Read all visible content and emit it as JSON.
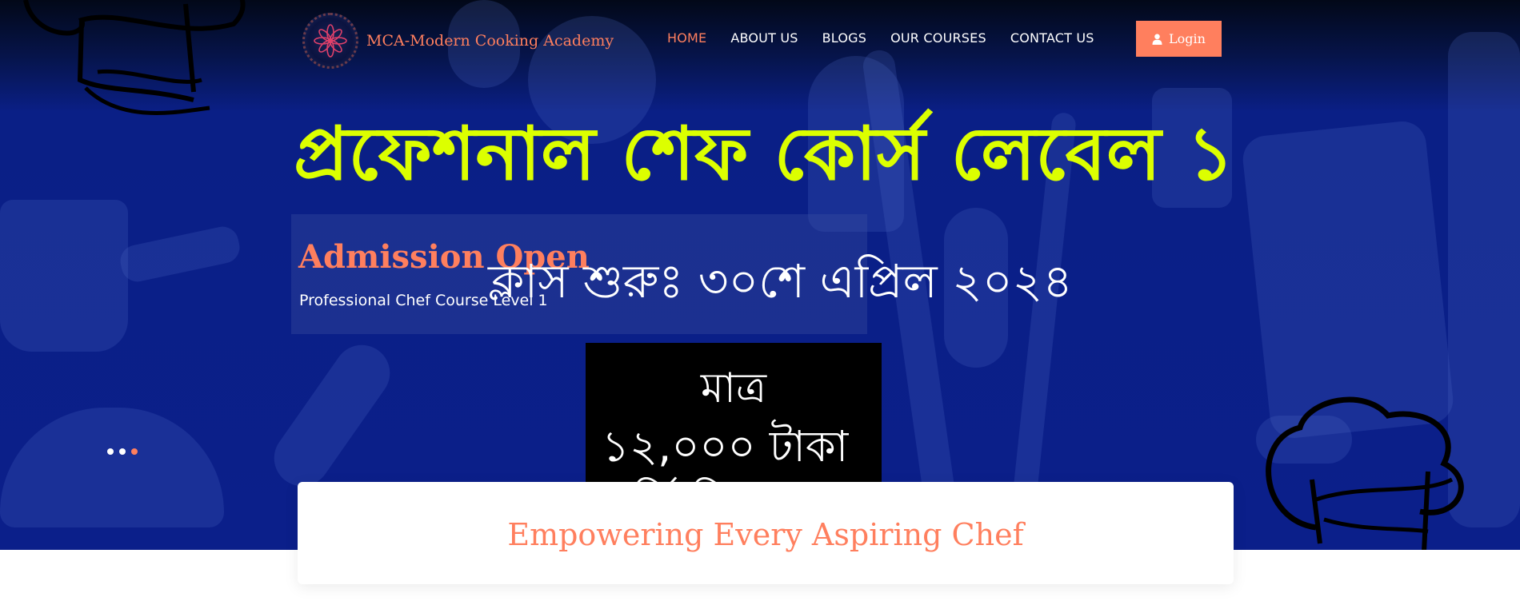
{
  "header": {
    "logo_text": "MCA-Modern Cooking Academy",
    "nav": [
      {
        "label": "HOME",
        "active": true
      },
      {
        "label": "ABOUT US",
        "active": false
      },
      {
        "label": "BLOGS",
        "active": false
      },
      {
        "label": "OUR COURSES",
        "active": false
      },
      {
        "label": "CONTACT US",
        "active": false
      }
    ],
    "login_label": "Login"
  },
  "hero": {
    "title": "প্রফেশনাল শেফ কোর্স লেবেল ১",
    "admission_heading": "Admission Open",
    "admission_subheading": "Professional Chef Course Level 1",
    "class_start": "ক্লাস শুরুঃ ৩০শে এপ্রিল ২০২৪",
    "price_only": "মাত্র",
    "price_amount": "১২,০০০ টাকা",
    "price_more": "ভর্তি ফি সহ"
  },
  "slider": {
    "active_dot": 3,
    "dot_count": 3
  },
  "card": {
    "title": "Empowering Every Aspiring Chef"
  },
  "colors": {
    "accent": "#ff7f5e",
    "title_yellow": "#dcff00",
    "hero_blue": "#0b1f8a"
  }
}
